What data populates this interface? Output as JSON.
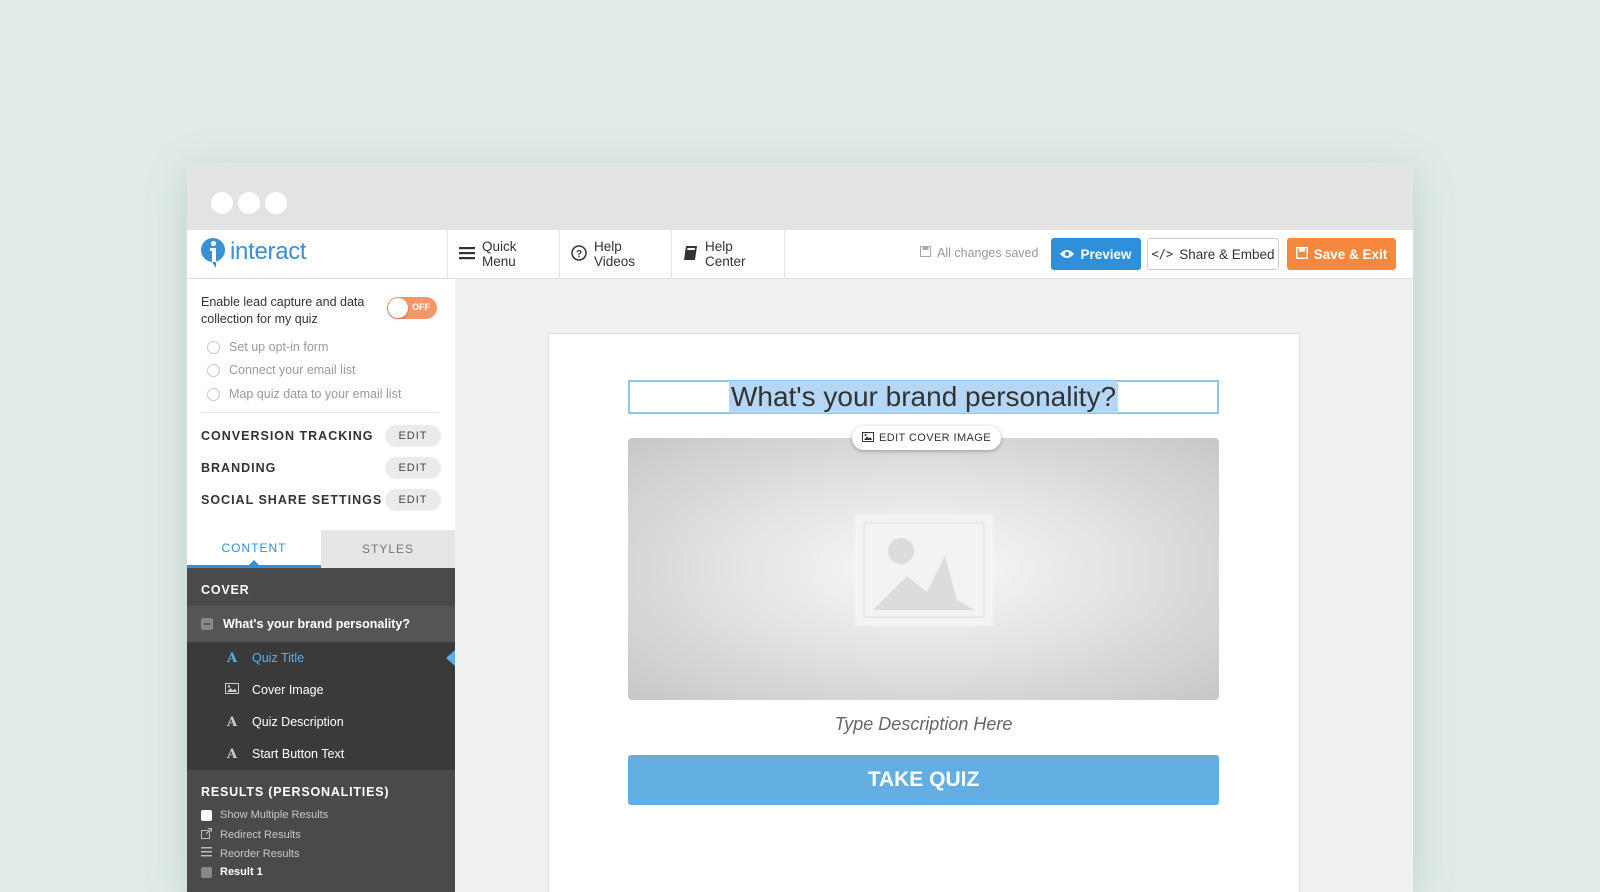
{
  "brand": {
    "name": "interact",
    "color": "#3a8fd5"
  },
  "nav": {
    "quick_menu": "Quick Menu",
    "help_videos": "Help Videos",
    "help_center": "Help Center",
    "save_status": "All changes saved",
    "preview": "Preview",
    "share": "Share & Embed",
    "save_exit": "Save & Exit"
  },
  "sidebar": {
    "lead_capture": {
      "label": "Enable lead capture and data collection for my quiz",
      "toggle": "OFF",
      "options": [
        "Set up opt-in form",
        "Connect your email list",
        "Map quiz data to your email list"
      ]
    },
    "settings": [
      {
        "label": "CONVERSION TRACKING",
        "action": "EDIT"
      },
      {
        "label": "BRANDING",
        "action": "EDIT"
      },
      {
        "label": "SOCIAL SHARE SETTINGS",
        "action": "EDIT"
      }
    ],
    "tabs": {
      "content": "CONTENT",
      "styles": "STYLES"
    },
    "cover": {
      "heading": "COVER",
      "item": "What's your brand personality?",
      "subitems": [
        {
          "icon": "A",
          "label": "Quiz Title"
        },
        {
          "icon": "image-icon",
          "label": "Cover Image"
        },
        {
          "icon": "A",
          "label": "Quiz Description"
        },
        {
          "icon": "A",
          "label": "Start Button Text"
        }
      ]
    },
    "results": {
      "heading": "RESULTS (PERSONALITIES)",
      "options": [
        "Show Multiple Results",
        "Redirect Results",
        "Reorder Results"
      ],
      "first_result": "Result 1"
    }
  },
  "quiz": {
    "title": "What's your brand personality?",
    "edit_cover": "EDIT COVER IMAGE",
    "description_placeholder": "Type Description Here",
    "button": "TAKE QUIZ"
  },
  "colors": {
    "primary": "#2f8fdb",
    "orange": "#f5883c",
    "toggle_off": "#f5966a",
    "quiz_button": "#62ade2",
    "background": "#e2ebe8"
  }
}
